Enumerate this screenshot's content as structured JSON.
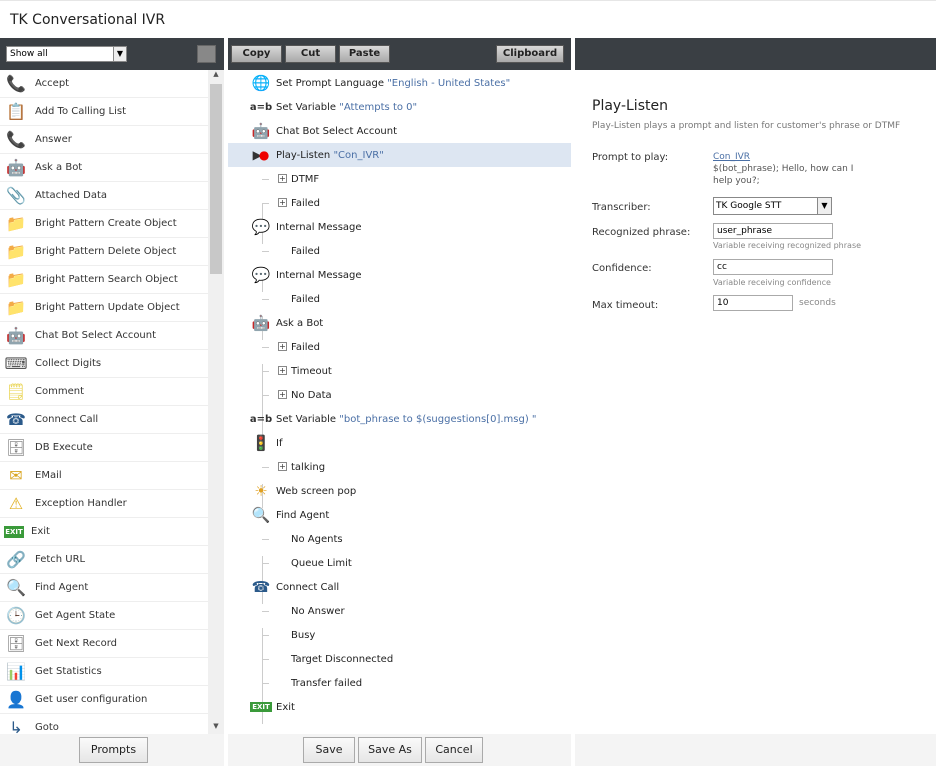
{
  "app": {
    "title": "TK Conversational IVR"
  },
  "palette": {
    "filter_value": "Show all",
    "items": [
      {
        "label": "Accept",
        "icon": "phone-accept-icon",
        "glyph": "📞",
        "color": "#3a9a3a"
      },
      {
        "label": "Add To Calling List",
        "icon": "list-add-icon",
        "glyph": "📋",
        "color": "#444"
      },
      {
        "label": "Answer",
        "icon": "phone-answer-icon",
        "glyph": "📞",
        "color": "#3a9a3a"
      },
      {
        "label": "Ask a Bot",
        "icon": "robot-question-icon",
        "glyph": "🤖",
        "color": "#2b4a7a"
      },
      {
        "label": "Attached Data",
        "icon": "paperclip-icon",
        "glyph": "📎",
        "color": "#5a7ab0"
      },
      {
        "label": "Bright Pattern Create Object",
        "icon": "folder-add-icon",
        "glyph": "📁",
        "color": "#d9a520"
      },
      {
        "label": "Bright Pattern Delete Object",
        "icon": "folder-delete-icon",
        "glyph": "📁",
        "color": "#d9a520"
      },
      {
        "label": "Bright Pattern Search Object",
        "icon": "folder-search-icon",
        "glyph": "📁",
        "color": "#d9a520"
      },
      {
        "label": "Bright Pattern Update Object",
        "icon": "folder-update-icon",
        "glyph": "📁",
        "color": "#d9a520"
      },
      {
        "label": "Chat Bot Select Account",
        "icon": "robot-select-icon",
        "glyph": "🤖",
        "color": "#2b4a7a"
      },
      {
        "label": "Collect Digits",
        "icon": "keypad-icon",
        "glyph": "⌨",
        "color": "#555"
      },
      {
        "label": "Comment",
        "icon": "note-icon",
        "glyph": "🗒",
        "color": "#e8d24a"
      },
      {
        "label": "Connect Call",
        "icon": "phone-connect-icon",
        "glyph": "☎",
        "color": "#2b5a8a"
      },
      {
        "label": "DB Execute",
        "icon": "database-icon",
        "glyph": "🗄",
        "color": "#777"
      },
      {
        "label": "EMail",
        "icon": "envelope-icon",
        "glyph": "✉",
        "color": "#d9a520"
      },
      {
        "label": "Exception Handler",
        "icon": "warning-icon",
        "glyph": "⚠",
        "color": "#e0b020"
      },
      {
        "label": "Exit",
        "icon": "exit-icon",
        "glyph": "EXIT",
        "color": "#3a9a3a"
      },
      {
        "label": "Fetch URL",
        "icon": "link-icon",
        "glyph": "🔗",
        "color": "#777"
      },
      {
        "label": "Find Agent",
        "icon": "magnifier-icon",
        "glyph": "🔍",
        "color": "#2b5a8a"
      },
      {
        "label": "Get Agent State",
        "icon": "clock-icon",
        "glyph": "🕒",
        "color": "#3a9a3a"
      },
      {
        "label": "Get Next Record",
        "icon": "database-next-icon",
        "glyph": "🗄",
        "color": "#777"
      },
      {
        "label": "Get Statistics",
        "icon": "bar-chart-icon",
        "glyph": "📊",
        "color": "#555"
      },
      {
        "label": "Get user configuration",
        "icon": "user-icon",
        "glyph": "👤",
        "color": "#222"
      },
      {
        "label": "Goto",
        "icon": "goto-icon",
        "glyph": "↳",
        "color": "#2b5a8a"
      }
    ],
    "prompts_label": "Prompts"
  },
  "toolbar": {
    "copy": "Copy",
    "cut": "Cut",
    "paste": "Paste",
    "clipboard": "Clipboard"
  },
  "flow": {
    "set_prompt_language": {
      "name": "Set Prompt Language",
      "arg": "\"English - United States\""
    },
    "set_var1": {
      "name": "Set Variable",
      "arg": "\"Attempts to 0\""
    },
    "chatbot_select": {
      "name": "Chat Bot Select Account"
    },
    "play_listen": {
      "name": "Play-Listen",
      "arg": "\"Con_IVR\""
    },
    "dtmf": "DTMF",
    "failed": "Failed",
    "internal_message": "Internal Message",
    "ask_a_bot": "Ask a Bot",
    "timeout": "Timeout",
    "no_data": "No Data",
    "set_var2": {
      "name": "Set Variable",
      "arg": "\"bot_phrase to $(suggestions[0].msg) \""
    },
    "if": "If",
    "talking": "talking",
    "web_screen_pop": "Web screen pop",
    "find_agent": "Find Agent",
    "no_agents": "No Agents",
    "queue_limit": "Queue Limit",
    "connect_call": "Connect Call",
    "no_answer": "No Answer",
    "busy": "Busy",
    "target_disconnected": "Target Disconnected",
    "transfer_failed": "Transfer failed",
    "exit": "Exit",
    "ab_glyph": "a=b",
    "exit_glyph": "EXIT"
  },
  "footer": {
    "save": "Save",
    "save_as": "Save As",
    "cancel": "Cancel"
  },
  "props": {
    "title": "Play-Listen",
    "description": "Play-Listen plays a prompt and listen for customer's phrase or DTMF",
    "prompt_label": "Prompt to play:",
    "prompt_link": "Con_IVR",
    "prompt_text": "$(bot_phrase); Hello, how can I help you?;",
    "transcriber_label": "Transcriber:",
    "transcriber_value": "TK Google STT",
    "phrase_label": "Recognized phrase:",
    "phrase_value": "user_phrase",
    "phrase_hint": "Variable receiving recognized phrase",
    "confidence_label": "Confidence:",
    "confidence_value": "cc",
    "confidence_hint": "Variable receiving confidence",
    "timeout_label": "Max timeout:",
    "timeout_value": "10",
    "timeout_unit": "seconds"
  }
}
